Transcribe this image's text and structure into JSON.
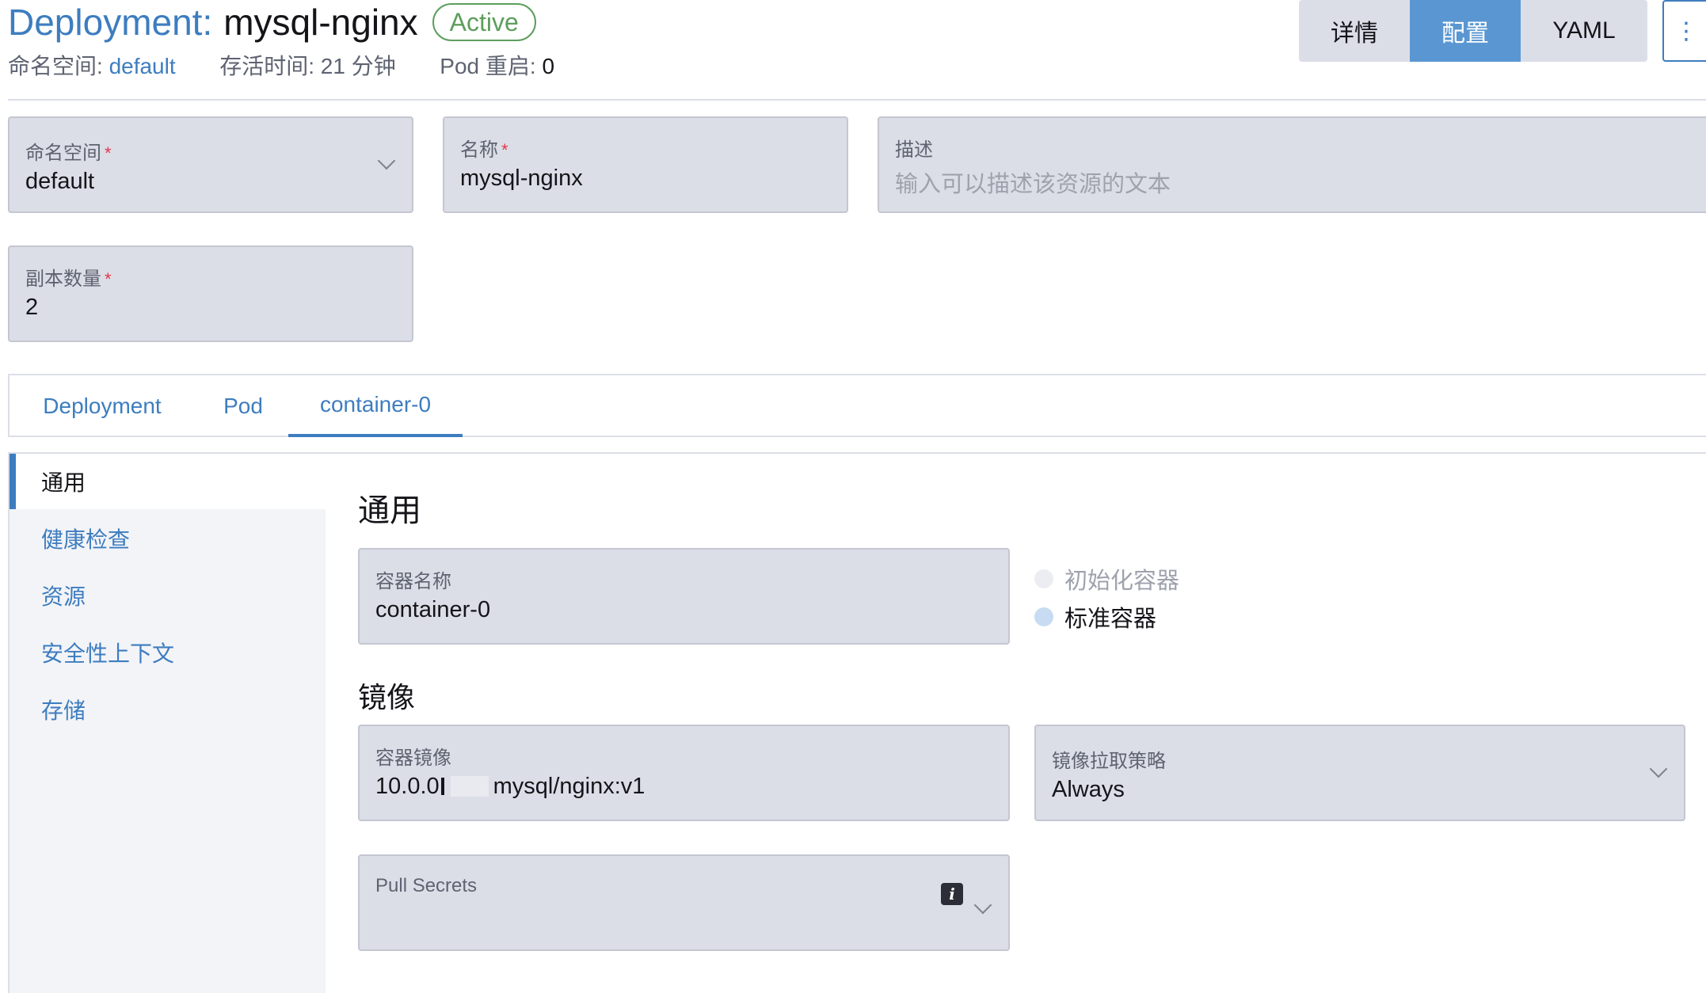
{
  "header": {
    "kind": "Deployment:",
    "name": "mysql-nginx",
    "status": "Active",
    "namespace_label": "命名空间:",
    "namespace_value": "default",
    "age_label": "存活时间:",
    "age_value": "21 分钟",
    "restarts_label": "Pod 重启:",
    "restarts_value": "0"
  },
  "view_buttons": [
    {
      "label": "详情",
      "active": false
    },
    {
      "label": "配置",
      "active": true
    },
    {
      "label": "YAML",
      "active": false
    }
  ],
  "kebab_icon": "⋮",
  "form": {
    "namespace": {
      "label": "命名空间",
      "required": "*",
      "value": "default"
    },
    "name": {
      "label": "名称",
      "required": "*",
      "value": "mysql-nginx"
    },
    "description": {
      "label": "描述",
      "placeholder": "输入可以描述该资源的文本"
    },
    "replicas": {
      "label": "副本数量",
      "required": "*",
      "value": "2"
    }
  },
  "tabs": [
    {
      "label": "Deployment",
      "active": false
    },
    {
      "label": "Pod",
      "active": false
    },
    {
      "label": "container-0",
      "active": true
    }
  ],
  "sidebar": [
    {
      "label": "通用",
      "active": true
    },
    {
      "label": "健康检查",
      "active": false
    },
    {
      "label": "资源",
      "active": false
    },
    {
      "label": "安全性上下文",
      "active": false
    },
    {
      "label": "存储",
      "active": false
    }
  ],
  "general": {
    "title": "通用",
    "container_name": {
      "label": "容器名称",
      "value": "container-0"
    },
    "container_type": {
      "init": "初始化容器",
      "standard": "标准容器",
      "selected": "standard"
    }
  },
  "image": {
    "title": "镜像",
    "container_image": {
      "label": "容器镜像",
      "value_prefix": "10.0.0",
      "value_suffix": "mysql/nginx:v1"
    },
    "pull_policy": {
      "label": "镜像拉取策略",
      "value": "Always"
    },
    "pull_secrets": {
      "label": "Pull Secrets",
      "icon": "info-icon"
    }
  },
  "colors": {
    "accent": "#3d7dbf",
    "active_button": "#5a97d2",
    "status_green": "#5d9e5d",
    "required_red": "#e0374d",
    "field_bg": "#dcdee7"
  }
}
